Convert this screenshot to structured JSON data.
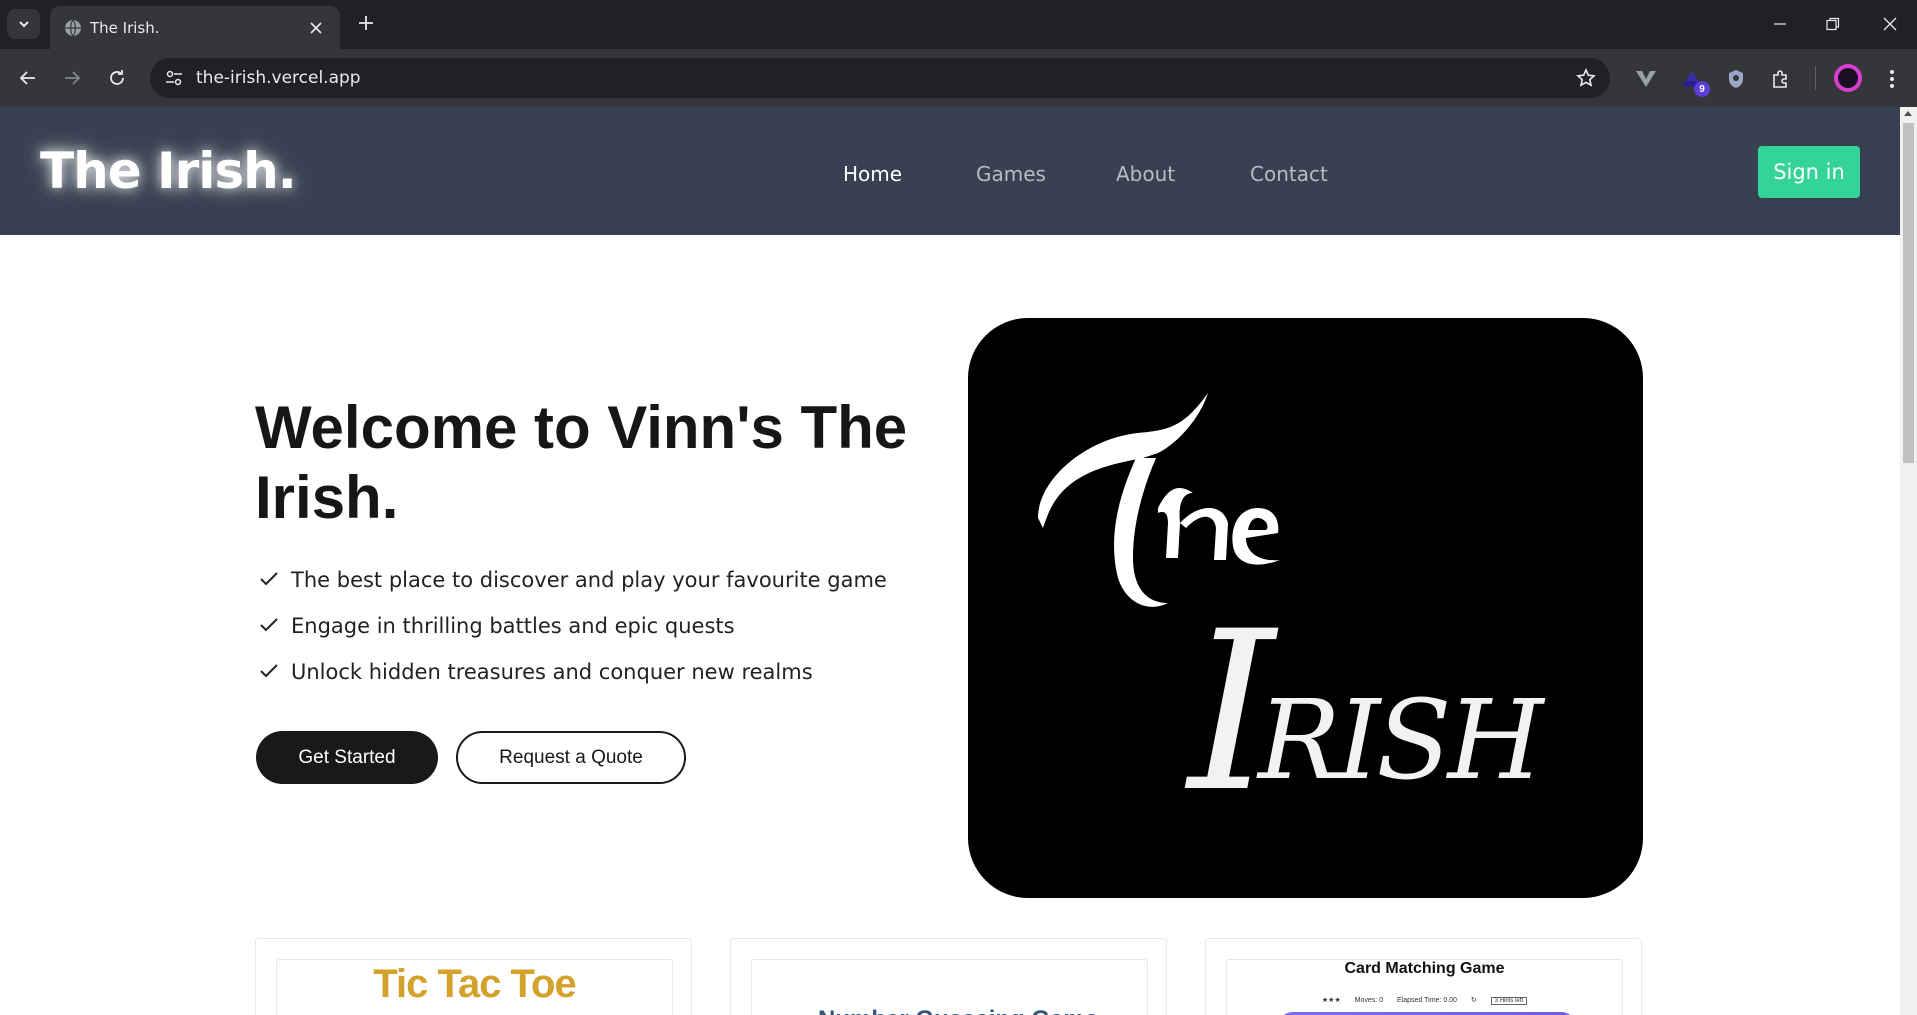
{
  "browser": {
    "tab_title": "The Irish.",
    "url": "the-irish.vercel.app",
    "extension_badge": "9"
  },
  "site": {
    "logo": "The Irish.",
    "nav": [
      {
        "label": "Home",
        "active": true
      },
      {
        "label": "Games",
        "active": false
      },
      {
        "label": "About",
        "active": false
      },
      {
        "label": "Contact",
        "active": false
      }
    ],
    "signin_label": "Sign in",
    "accent_color": "#34d399",
    "header_color": "#374151"
  },
  "hero": {
    "title": "Welcome to Vinn's The Irish.",
    "features": [
      "The best place to discover and play your favourite game",
      "Engage in thrilling battles and epic quests",
      "Unlock hidden treasures and conquer new realms"
    ],
    "primary_button": "Get Started",
    "secondary_button": "Request a Quote",
    "image_text_line1": "The",
    "image_text_line2": "Irish"
  },
  "games": [
    {
      "title": "Tic Tac Toe"
    },
    {
      "title": "Number Guessing Game"
    },
    {
      "title": "Card Matching Game",
      "stats": {
        "stars": "★★★",
        "moves": "Moves: 0",
        "elapsed": "Elapsed Time: 0.00",
        "hints": "3 Hints left"
      }
    }
  ]
}
